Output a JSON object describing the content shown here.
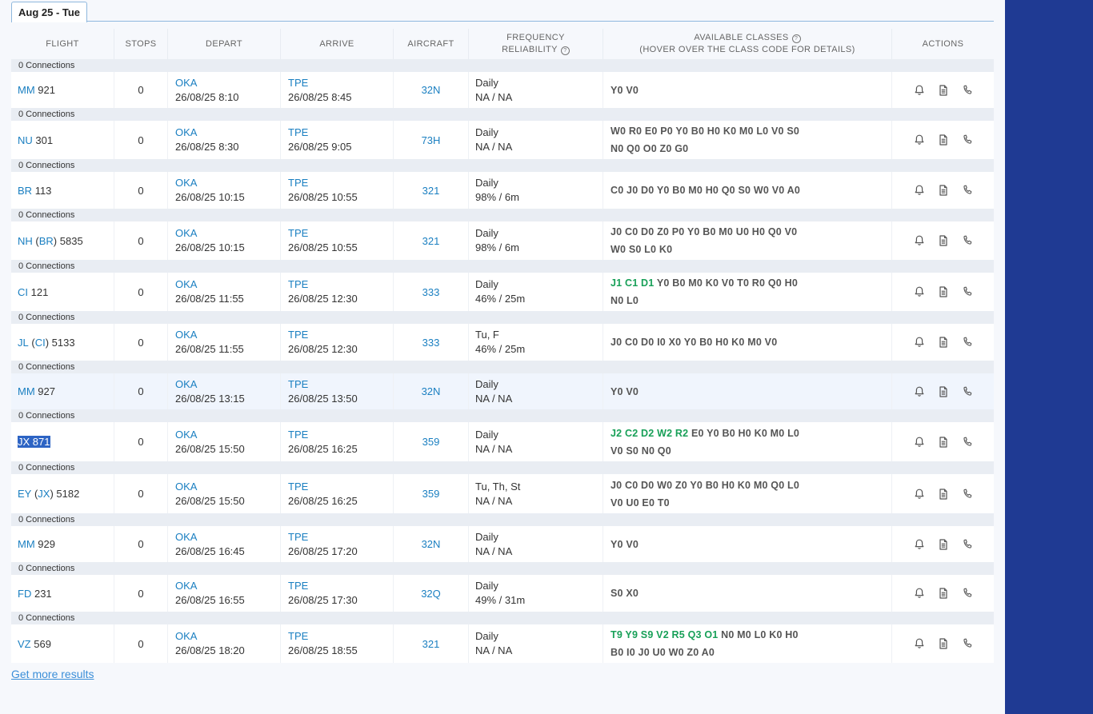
{
  "tab": {
    "label": "Aug 25 - Tue"
  },
  "headers": {
    "flight": "FLIGHT",
    "stops": "STOPS",
    "depart": "DEPART",
    "arrive": "ARRIVE",
    "aircraft": "AIRCRAFT",
    "frequency": "FREQUENCY",
    "reliability": "RELIABILITY",
    "classes": "AVAILABLE CLASSES",
    "classes_hint": "(HOVER OVER THE CLASS CODE FOR DETAILS)",
    "actions": "ACTIONS"
  },
  "icons": {
    "help": "help-circle-icon",
    "alert": "bell-icon",
    "details": "document-icon",
    "contact": "phone-icon",
    "help_glyph": "?"
  },
  "colors": {
    "accent": "#1a7fc1",
    "available_class": "#18a058",
    "panel": "#1f3a93"
  },
  "rows": [
    {
      "connections": "0 Connections",
      "airline": "MM",
      "op": "",
      "number": "921",
      "stops": "0",
      "dep_code": "OKA",
      "dep_time": "26/08/25 8:10",
      "arr_code": "TPE",
      "arr_time": "26/08/25 8:45",
      "aircraft": "32N",
      "frequency": "Daily",
      "reliability": "NA / NA",
      "classes_green": "",
      "classes_line1": "Y0 V0",
      "classes_line2": "",
      "height": 45
    },
    {
      "connections": "0 Connections",
      "airline": "NU",
      "op": "",
      "number": "301",
      "stops": "0",
      "dep_code": "OKA",
      "dep_time": "26/08/25 8:30",
      "arr_code": "TPE",
      "arr_time": "26/08/25 9:05",
      "aircraft": "73H",
      "frequency": "Daily",
      "reliability": "NA / NA",
      "classes_green": "",
      "classes_line1": "W0 R0 E0 P0 Y0 B0 H0 K0 M0 L0 V0 S0",
      "classes_line2": "N0 Q0 O0 Z0 G0",
      "height": 48
    },
    {
      "connections": "0 Connections",
      "airline": "BR",
      "op": "",
      "number": "113",
      "stops": "0",
      "dep_code": "OKA",
      "dep_time": "26/08/25 10:15",
      "arr_code": "TPE",
      "arr_time": "26/08/25 10:55",
      "aircraft": "321",
      "frequency": "Daily",
      "reliability": "98% / 6m",
      "classes_green": "",
      "classes_line1": "C0 J0 D0 Y0 B0 M0 H0 Q0 S0 W0 V0 A0",
      "classes_line2": "",
      "height": 46
    },
    {
      "connections": "0 Connections",
      "airline": "NH",
      "op": "BR",
      "number": "5835",
      "stops": "0",
      "dep_code": "OKA",
      "dep_time": "26/08/25 10:15",
      "arr_code": "TPE",
      "arr_time": "26/08/25 10:55",
      "aircraft": "321",
      "frequency": "Daily",
      "reliability": "98% / 6m",
      "classes_green": "",
      "classes_line1": "J0 C0 D0 Z0 P0 Y0 B0 M0 U0 H0 Q0 V0",
      "classes_line2": "W0 S0 L0 K0",
      "height": 48
    },
    {
      "connections": "0 Connections",
      "airline": "CI",
      "op": "",
      "number": "121",
      "stops": "0",
      "dep_code": "OKA",
      "dep_time": "26/08/25 11:55",
      "arr_code": "TPE",
      "arr_time": "26/08/25 12:30",
      "aircraft": "333",
      "frequency": "Daily",
      "reliability": "46% / 25m",
      "classes_green": "J1 C1 D1",
      "classes_line1": "Y0 B0 M0 K0 V0 T0 R0 Q0 H0",
      "classes_line2": "N0 L0",
      "height": 48
    },
    {
      "connections": "0 Connections",
      "airline": "JL",
      "op": "CI",
      "number": "5133",
      "stops": "0",
      "dep_code": "OKA",
      "dep_time": "26/08/25 11:55",
      "arr_code": "TPE",
      "arr_time": "26/08/25 12:30",
      "aircraft": "333",
      "frequency": "Tu, F",
      "reliability": "46% / 25m",
      "classes_green": "",
      "classes_line1": "J0 C0 D0 I0 X0 Y0 B0 H0 K0 M0 V0",
      "classes_line2": "",
      "height": 46
    },
    {
      "connections": "0 Connections",
      "airline": "MM",
      "op": "",
      "number": "927",
      "stops": "0",
      "dep_code": "OKA",
      "dep_time": "26/08/25 13:15",
      "arr_code": "TPE",
      "arr_time": "26/08/25 13:50",
      "aircraft": "32N",
      "frequency": "Daily",
      "reliability": "NA / NA",
      "classes_green": "",
      "classes_line1": "Y0 V0",
      "classes_line2": "",
      "height": 45,
      "selected": true
    },
    {
      "connections": "0 Connections",
      "airline": "JX",
      "op": "",
      "number": "871",
      "stops": "0",
      "dep_code": "OKA",
      "dep_time": "26/08/25 15:50",
      "arr_code": "TPE",
      "arr_time": "26/08/25 16:25",
      "aircraft": "359",
      "frequency": "Daily",
      "reliability": "NA / NA",
      "classes_green": "J2 C2 D2 W2 R2",
      "classes_line1": "E0 Y0 B0 H0 K0 M0 L0",
      "classes_line2": "V0 S0 N0 Q0",
      "height": 49,
      "highlight": true
    },
    {
      "connections": "0 Connections",
      "airline": "EY",
      "op": "JX",
      "number": "5182",
      "stops": "0",
      "dep_code": "OKA",
      "dep_time": "26/08/25 15:50",
      "arr_code": "TPE",
      "arr_time": "26/08/25 16:25",
      "aircraft": "359",
      "frequency": "Tu, Th, St",
      "reliability": "NA / NA",
      "classes_green": "",
      "classes_line1": "J0 C0 D0 W0 Z0 Y0 B0 H0 K0 M0 Q0 L0",
      "classes_line2": "V0 U0 E0 T0",
      "height": 49
    },
    {
      "connections": "0 Connections",
      "airline": "MM",
      "op": "",
      "number": "929",
      "stops": "0",
      "dep_code": "OKA",
      "dep_time": "26/08/25 16:45",
      "arr_code": "TPE",
      "arr_time": "26/08/25 17:20",
      "aircraft": "32N",
      "frequency": "Daily",
      "reliability": "NA / NA",
      "classes_green": "",
      "classes_line1": "Y0 V0",
      "classes_line2": "",
      "height": 45
    },
    {
      "connections": "0 Connections",
      "airline": "FD",
      "op": "",
      "number": "231",
      "stops": "0",
      "dep_code": "OKA",
      "dep_time": "26/08/25 16:55",
      "arr_code": "TPE",
      "arr_time": "26/08/25 17:30",
      "aircraft": "32Q",
      "frequency": "Daily",
      "reliability": "49% / 31m",
      "classes_green": "",
      "classes_line1": "S0 X0",
      "classes_line2": "",
      "height": 46
    },
    {
      "connections": "0 Connections",
      "airline": "VZ",
      "op": "",
      "number": "569",
      "stops": "0",
      "dep_code": "OKA",
      "dep_time": "26/08/25 18:20",
      "arr_code": "TPE",
      "arr_time": "26/08/25 18:55",
      "aircraft": "321",
      "frequency": "Daily",
      "reliability": "NA / NA",
      "classes_green": "T9 Y9 S9 V2 R5 Q3 O1",
      "classes_line1": "N0 M0 L0 K0 H0",
      "classes_line2": "B0 I0 J0 U0 W0 Z0 A0",
      "height": 48
    }
  ],
  "footer": {
    "more_results": "Get more results"
  }
}
